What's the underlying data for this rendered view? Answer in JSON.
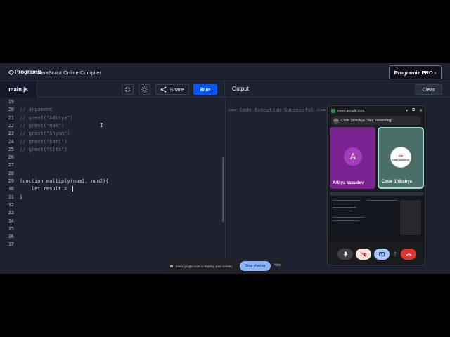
{
  "header": {
    "logo": "Programiz",
    "title": "JavaScript Online Compiler",
    "pro_button": "Programiz PRO ›"
  },
  "toolbar": {
    "file_tab": "main.js",
    "share_label": "Share",
    "run_label": "Run",
    "output_title": "Output",
    "clear_label": "Clear"
  },
  "editor": {
    "lines": [
      {
        "n": "19",
        "code": "",
        "kind": "plain"
      },
      {
        "n": "20",
        "code": "// argument",
        "kind": "comment"
      },
      {
        "n": "21",
        "code": "// greet(\"Aditya\")",
        "kind": "comment"
      },
      {
        "n": "22",
        "code": "// greet(\"Ram\")",
        "kind": "comment"
      },
      {
        "n": "23",
        "code": "// greet(\"Shyam\")",
        "kind": "comment"
      },
      {
        "n": "24",
        "code": "// greet(\"hari\")",
        "kind": "comment"
      },
      {
        "n": "25",
        "code": "// greet(\"Sita\")",
        "kind": "comment"
      },
      {
        "n": "26",
        "code": "",
        "kind": "plain"
      },
      {
        "n": "27",
        "code": "",
        "kind": "plain"
      },
      {
        "n": "28",
        "code": "",
        "kind": "plain"
      },
      {
        "n": "29",
        "code": "function multiply(num1, num2){",
        "kind": "code"
      },
      {
        "n": "30",
        "code": "    let result = ",
        "kind": "code"
      },
      {
        "n": "31",
        "code": "}",
        "kind": "code"
      },
      {
        "n": "32",
        "code": "",
        "kind": "plain"
      },
      {
        "n": "33",
        "code": "",
        "kind": "plain"
      },
      {
        "n": "34",
        "code": "",
        "kind": "plain"
      },
      {
        "n": "35",
        "code": "",
        "kind": "plain"
      },
      {
        "n": "36",
        "code": "",
        "kind": "plain"
      },
      {
        "n": "37",
        "code": "",
        "kind": "plain"
      }
    ]
  },
  "output": {
    "text": "=== Code Execution Successful ==="
  },
  "meet": {
    "url": "meet.google.com",
    "presenting_label": "Code Shikshya (You, presenting)",
    "participant1_initial": "A",
    "participant1_name": "Aditya Vasudev",
    "participant2_name": "Code Shikshya",
    "participant2_logo_text": "CODE SHIKSHYA"
  },
  "share_bar": {
    "message": "meet.google.com is sharing your screen.",
    "stop_label": "Stop sharing",
    "hide_label": "Hide"
  }
}
